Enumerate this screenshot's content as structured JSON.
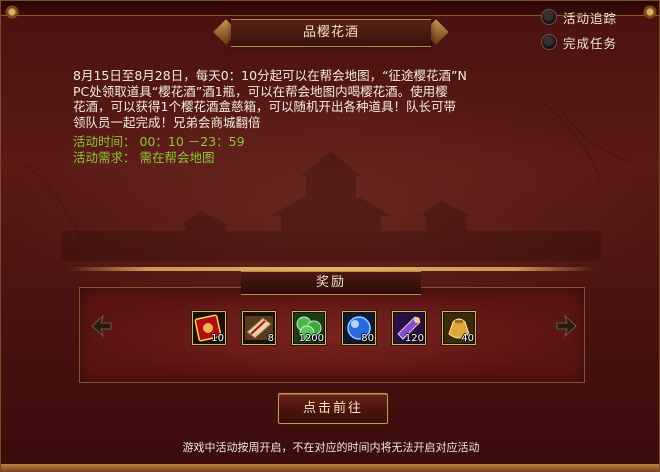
{
  "window": {
    "title": "品樱花酒"
  },
  "side_options": [
    {
      "label": "活动追踪"
    },
    {
      "label": "完成任务"
    }
  ],
  "description": {
    "lines": [
      "8月15日至8月28日，每天0：10分起可以在帮会地图，“征途樱花酒”N",
      "PC处领取道具“樱花酒”酒1瓶，可以在帮会地图内喝樱花酒。使用樱",
      "花酒，可以获得1个樱花酒盒慈箱，可以随机开出各种道具！队长可带",
      "领队员一起完成！兄弟会商城翻倍"
    ],
    "time_line": "活动时间： 00：10 －23：59",
    "requirement_line": "活动需求： 需在帮会地图"
  },
  "reward": {
    "title": "奖励",
    "items": [
      {
        "icon": "red-token-icon",
        "count": "10"
      },
      {
        "icon": "scroll-bundle-icon",
        "count": "8"
      },
      {
        "icon": "green-coins-icon",
        "count": "1200"
      },
      {
        "icon": "blue-orb-icon",
        "count": "80"
      },
      {
        "icon": "purple-scroll-icon",
        "count": "120"
      },
      {
        "icon": "gold-bag-icon",
        "count": "40"
      }
    ]
  },
  "go_button": {
    "label": "点击前往"
  },
  "footer_note": "游戏中活动按周开启，不在对应的时间内将无法开启对应活动",
  "colors": {
    "background": "#4a1210",
    "highlight_green": "#8dc63a",
    "gold_border": "#d9b26a",
    "text": "#f3ede2"
  }
}
